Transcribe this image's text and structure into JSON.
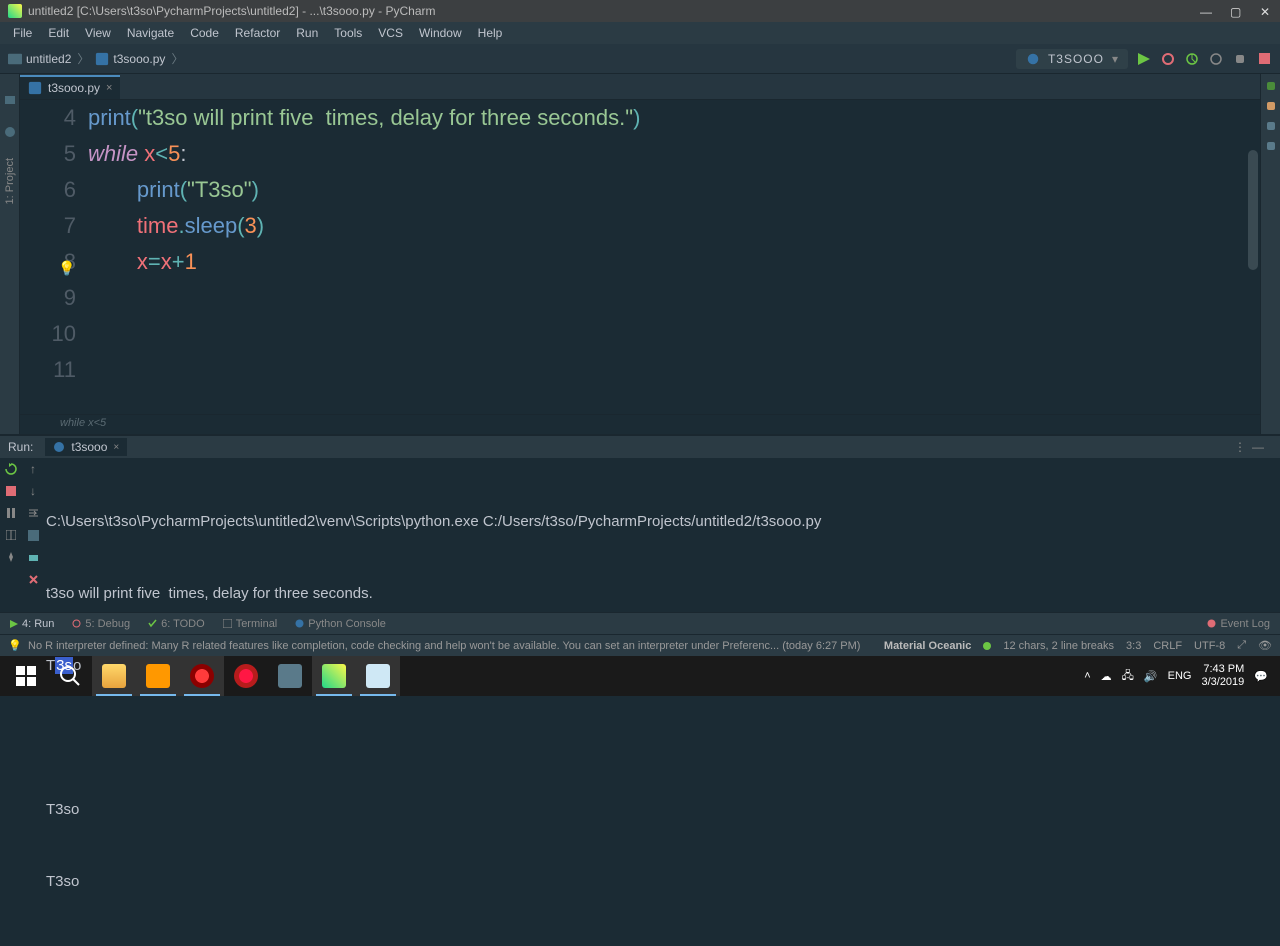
{
  "window": {
    "title": "untitled2 [C:\\Users\\t3so\\PycharmProjects\\untitled2] - ...\\t3sooo.py - PyCharm"
  },
  "menu": [
    "File",
    "Edit",
    "View",
    "Navigate",
    "Code",
    "Refactor",
    "Run",
    "Tools",
    "VCS",
    "Window",
    "Help"
  ],
  "breadcrumb": {
    "project": "untitled2",
    "file": "t3sooo.py"
  },
  "run_config": {
    "name": "T3SOOO"
  },
  "editor_tab": {
    "name": "t3sooo.py"
  },
  "code": {
    "lines": [
      4,
      5,
      6,
      7,
      8,
      9,
      10,
      11
    ],
    "l4_pre": "print",
    "l4_str": "\"t3so will print five  times, delay for three seconds.\"",
    "l5_kw": "while",
    "l5_var": " x",
    "l5_op": "<",
    "l5_num": "5",
    "l5_end": ":",
    "l6_fn": "print",
    "l6_str": "\"T3so\"",
    "l7_mod": "time",
    "l7_fn": "sleep",
    "l7_num": "3",
    "l8_var1": "x",
    "l8_op": "=",
    "l8_var2": "x",
    "l8_plus": "+",
    "l8_num": "1"
  },
  "context": "while x<5",
  "run_panel": {
    "label": "Run:",
    "tab": "t3sooo",
    "cmd": "C:\\Users\\t3so\\PycharmProjects\\untitled2\\venv\\Scripts\\python.exe C:/Users/t3so/PycharmProjects/untitled2/t3sooo.py",
    "out1": "t3so will print five  times, delay for three seconds.",
    "out2_pre": "T",
    "out2_sel": "3s",
    "out2_post": "o",
    "out3": "T3so",
    "out4": "T3so"
  },
  "bottom_tabs": {
    "run": "4: Run",
    "debug": "5: Debug",
    "todo": "6: TODO",
    "terminal": "Terminal",
    "console": "Python Console",
    "eventlog": "Event Log"
  },
  "status": {
    "msg": "No R interpreter defined: Many R related features like completion, code checking and help won't be available. You can set an interpreter under Preferenc... (today 6:27 PM)",
    "theme": "Material Oceanic",
    "sel": "12 chars, 2 line breaks",
    "pos": "3:3",
    "eol": "CRLF",
    "enc": "UTF-8",
    "lock": "⤢"
  },
  "taskbar": {
    "lang": "ENG",
    "time": "7:43 PM",
    "date": "3/3/2019"
  }
}
